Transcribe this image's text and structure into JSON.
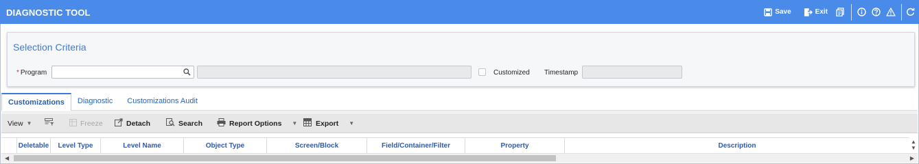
{
  "window": {
    "title": "DIAGNOSTIC TOOL",
    "actions": {
      "save": "Save",
      "exit": "Exit"
    },
    "icons": [
      "save-icon",
      "exit-icon",
      "report-icon",
      "info-icon",
      "help-icon",
      "warning-icon",
      "refresh-icon"
    ]
  },
  "criteria": {
    "title": "Selection Criteria",
    "program_label": "Program",
    "program_required_marker": "*",
    "program_value": "",
    "program_description": "",
    "customized_label": "Customized",
    "customized_checked": false,
    "timestamp_label": "Timestamp",
    "timestamp_value": ""
  },
  "tabs": [
    {
      "label": "Customizations",
      "active": true
    },
    {
      "label": "Diagnostic",
      "active": false
    },
    {
      "label": "Customizations Audit",
      "active": false
    }
  ],
  "toolbar": {
    "view": "View",
    "freeze": "Freeze",
    "detach": "Detach",
    "search": "Search",
    "report_options": "Report Options",
    "export": "Export"
  },
  "grid": {
    "columns": [
      "Deletable",
      "Level Type",
      "Level Name",
      "Object Type",
      "Screen/Block",
      "Field/Container/Filter",
      "Property",
      "Description"
    ],
    "rows": []
  },
  "colors": {
    "title_bar": "#4a8ae8",
    "link_blue": "#2a64bf",
    "section_title": "#3d7bd6"
  }
}
